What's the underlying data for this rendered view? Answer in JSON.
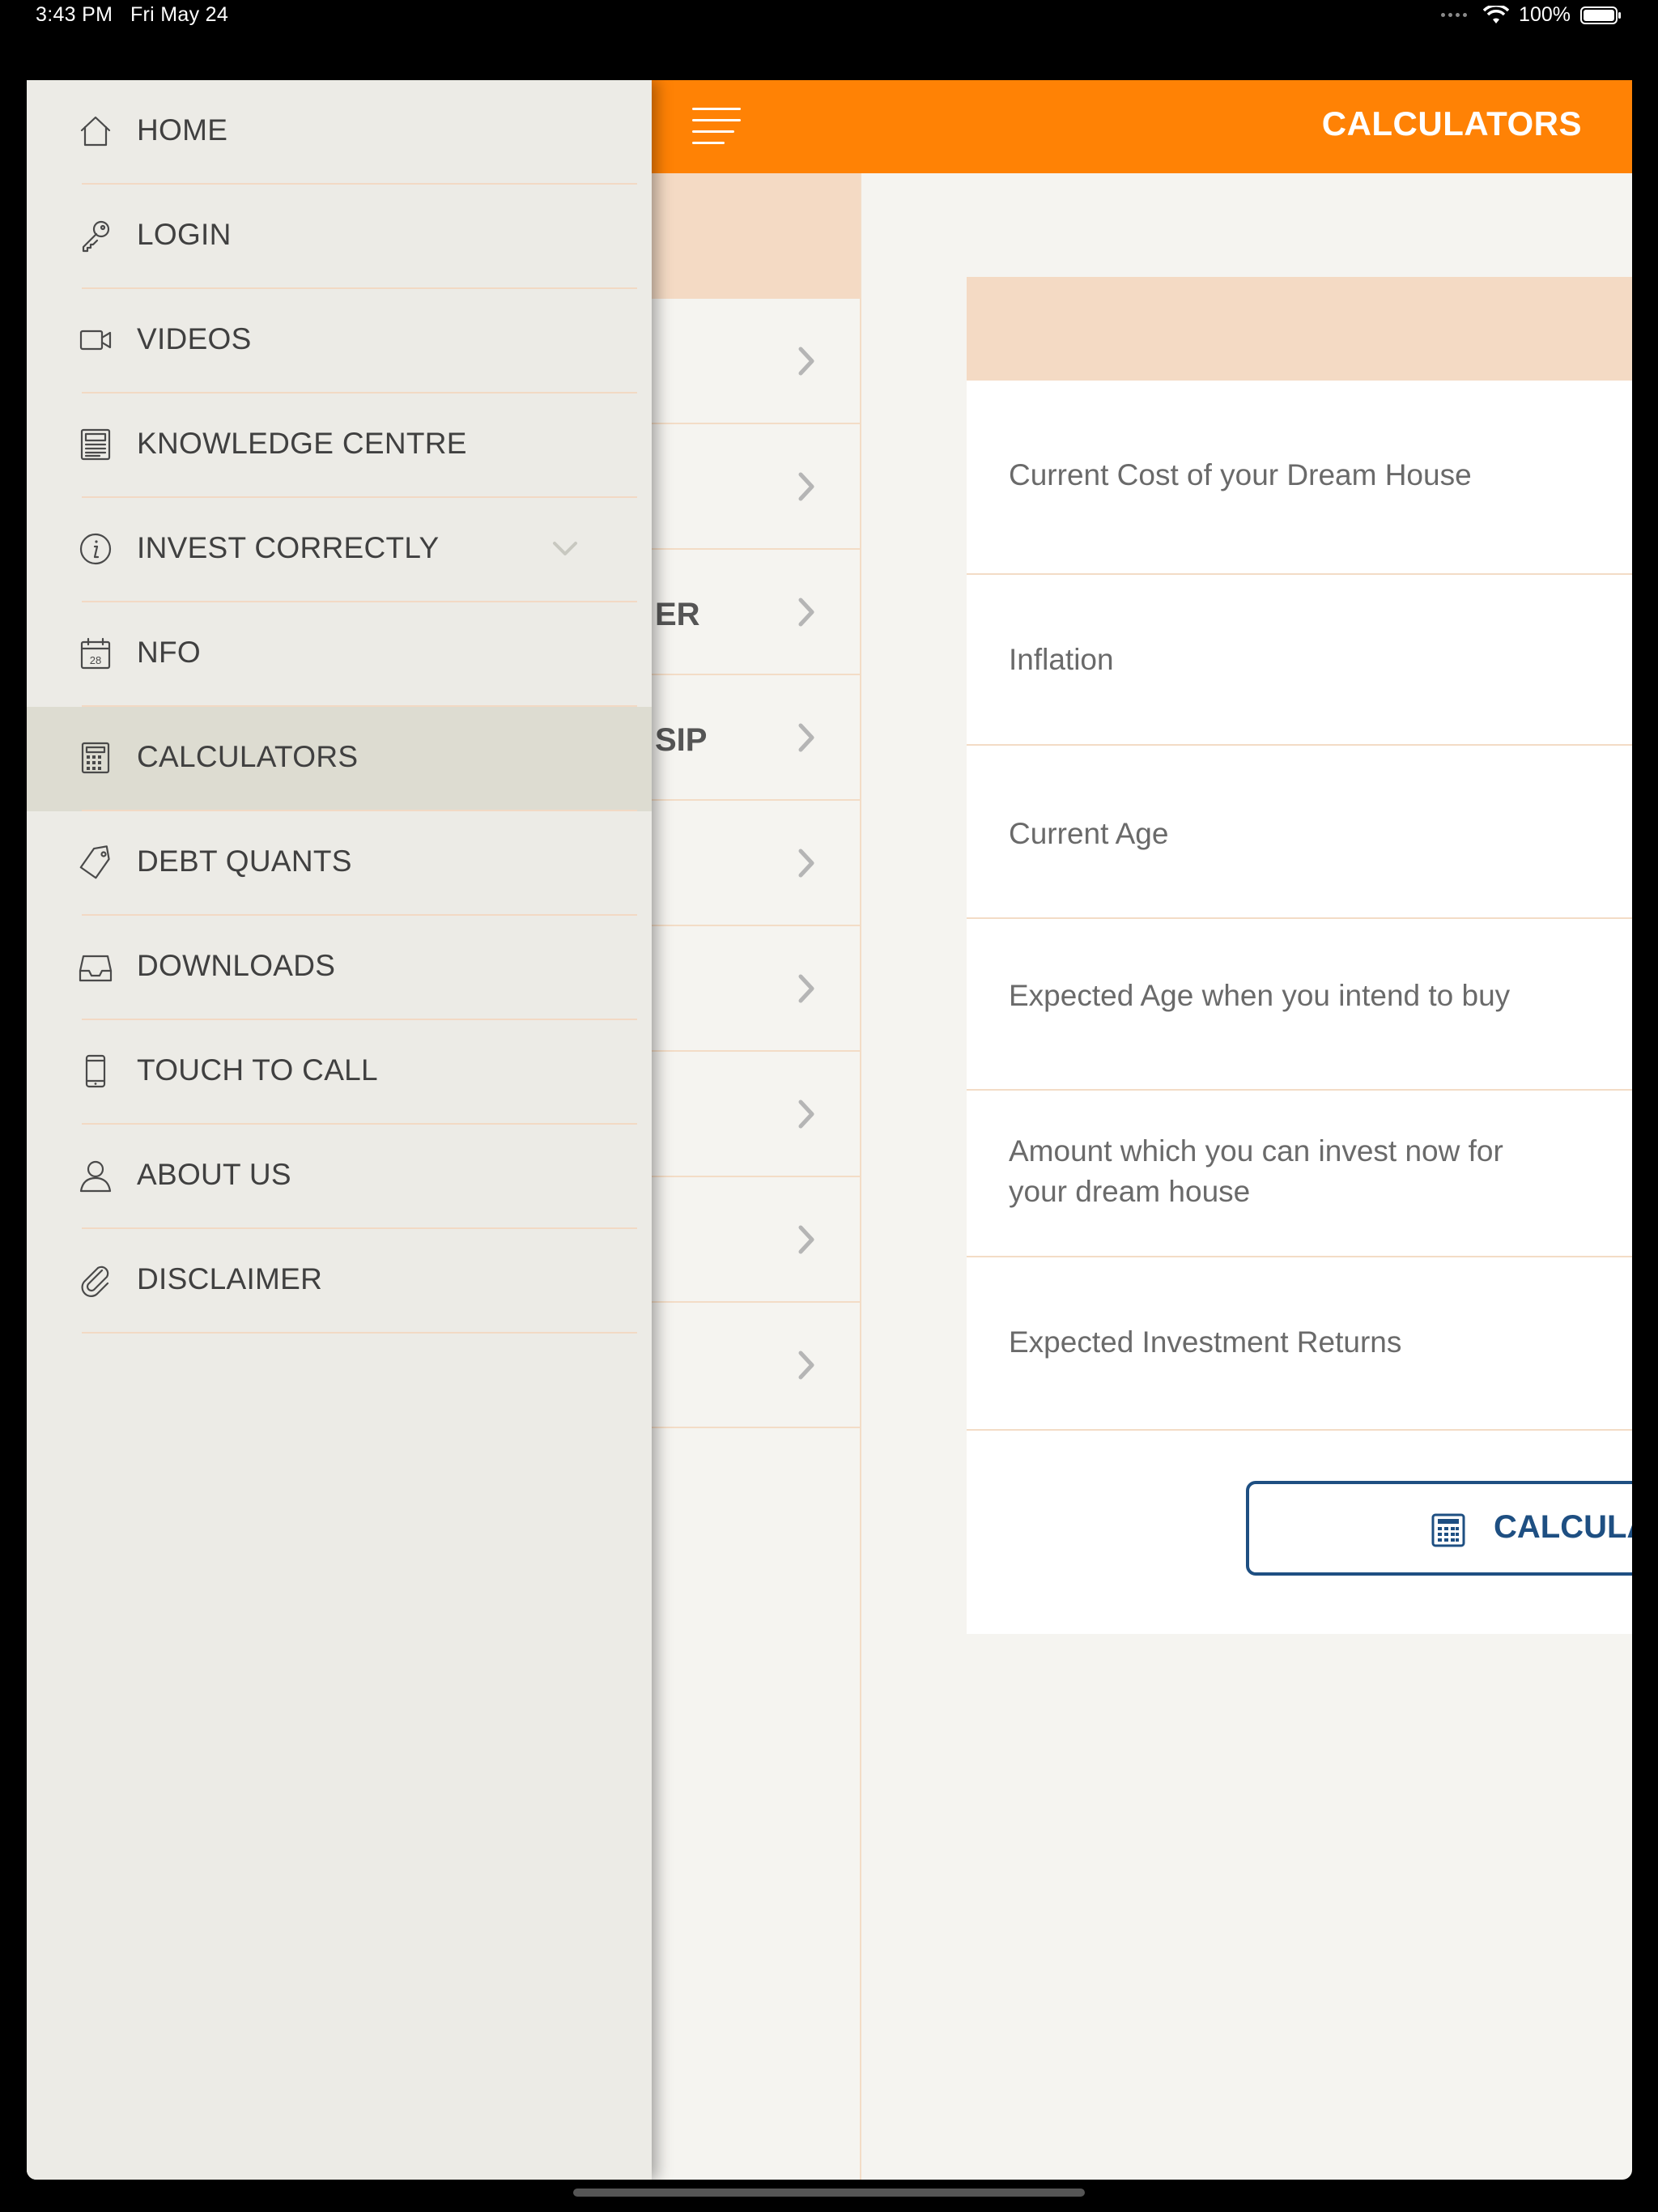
{
  "status_bar": {
    "time": "3:43 PM",
    "date": "Fri May 24",
    "battery": "100%"
  },
  "header": {
    "title": "CALCULATORS"
  },
  "calc_list": {
    "items": [
      {
        "label": ""
      },
      {
        "label": ""
      },
      {
        "label": "ER"
      },
      {
        "label": "SIP"
      },
      {
        "label": ""
      },
      {
        "label": ""
      },
      {
        "label": ""
      },
      {
        "label": ""
      },
      {
        "label": ""
      }
    ]
  },
  "form": {
    "fields": [
      {
        "label": "Current Cost of your Dream House"
      },
      {
        "label": "Inflation"
      },
      {
        "label": "Current Age"
      },
      {
        "label": "Expected Age when you intend to buy"
      },
      {
        "label": "Amount which you can invest now for your dream house"
      },
      {
        "label": "Expected Investment Returns"
      }
    ],
    "calculate_label": "CALCULATE"
  },
  "drawer": {
    "items": [
      {
        "label": "HOME",
        "icon": "home-icon"
      },
      {
        "label": "LOGIN",
        "icon": "key-icon"
      },
      {
        "label": "VIDEOS",
        "icon": "video-camera-icon"
      },
      {
        "label": "KNOWLEDGE CENTRE",
        "icon": "newspaper-icon"
      },
      {
        "label": "INVEST CORRECTLY",
        "icon": "info-icon"
      },
      {
        "label": "NFO",
        "icon": "calendar-icon"
      },
      {
        "label": "CALCULATORS",
        "icon": "calculator-icon"
      },
      {
        "label": "DEBT QUANTS",
        "icon": "tag-icon"
      },
      {
        "label": "DOWNLOADS",
        "icon": "inbox-icon"
      },
      {
        "label": "TOUCH TO CALL",
        "icon": "mobile-phone-icon"
      },
      {
        "label": "ABOUT US",
        "icon": "user-icon"
      },
      {
        "label": "DISCLAIMER",
        "icon": "paperclip-icon"
      }
    ],
    "calendar_icon_day": "28"
  },
  "colors": {
    "accent": "#ff8205",
    "header_strip": "#f4dac4",
    "divider": "#f3dcc6",
    "button_blue": "#1e4f82",
    "drawer_bg": "#ecebe6",
    "drawer_active": "#dddcd1"
  }
}
